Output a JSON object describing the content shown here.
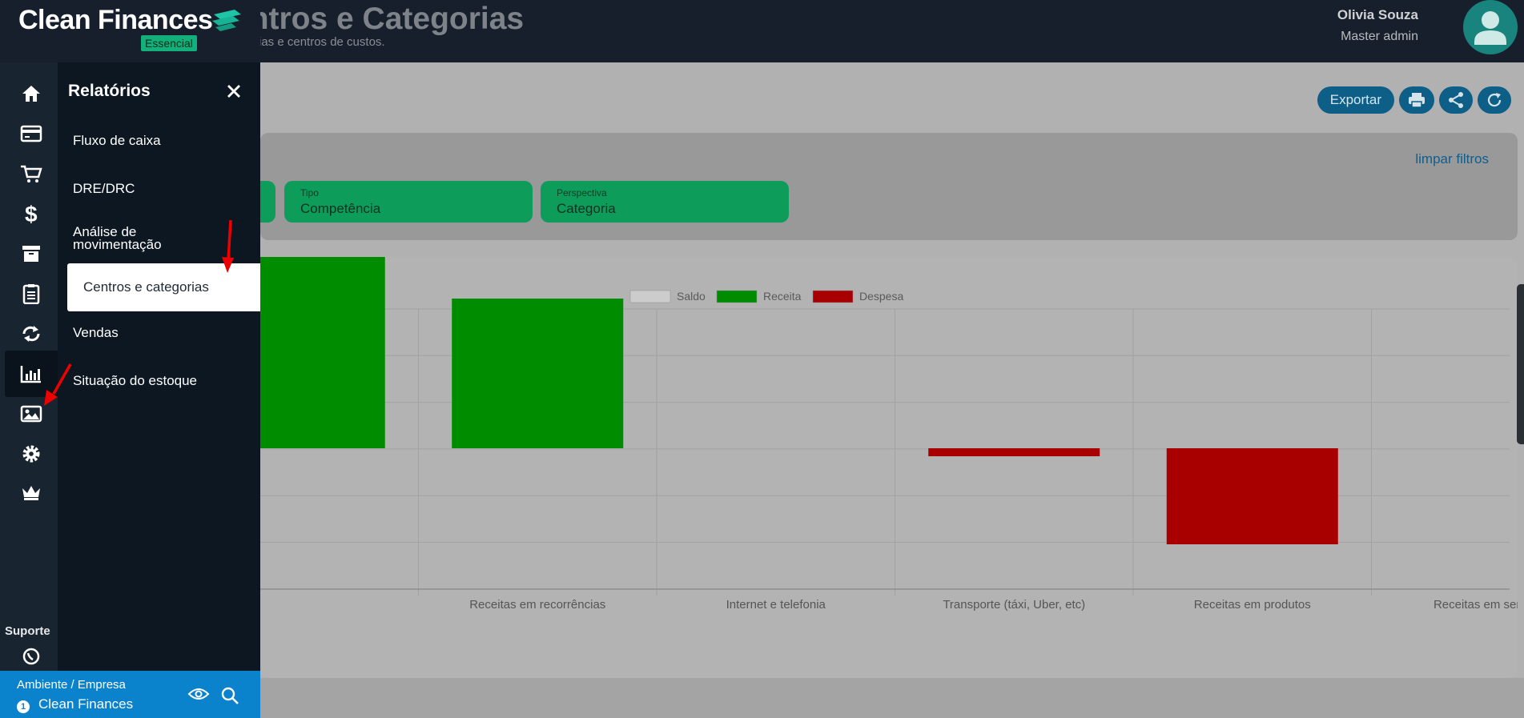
{
  "brand": {
    "name": "Clean Finances",
    "plan_badge": "Essencial"
  },
  "header": {
    "title": "entros e Categorias",
    "subtitle": "rias e centros de custos.",
    "user_name": "Olivia Souza",
    "user_role": "Master admin"
  },
  "rail": {
    "icons": [
      "home-icon",
      "credit-card-icon",
      "cart-icon",
      "dollar-icon",
      "archive-icon",
      "clipboard-icon",
      "transfer-icon",
      "bar-chart-icon",
      "image-icon",
      "gear-icon",
      "crown-icon",
      "whatsapp-icon"
    ],
    "active_icon": "bar-chart-icon",
    "support_label": "Suporte"
  },
  "submenu": {
    "title": "Relatórios",
    "items": [
      {
        "label": "Fluxo de caixa"
      },
      {
        "label": "DRE/DRC"
      },
      {
        "label": "Análise de movimentação"
      },
      {
        "label": "Centros e categorias",
        "active": true
      },
      {
        "label": "Vendas"
      },
      {
        "label": "Situação do estoque"
      }
    ]
  },
  "footer": {
    "env_label": "Ambiente / Empresa",
    "env_number": "1",
    "env_name": "Clean Finances"
  },
  "toolbar": {
    "export_label": "Exportar",
    "icons": [
      "print-icon",
      "share-icon",
      "refresh-icon"
    ]
  },
  "filters": {
    "clear_label": "limpar filtros",
    "tipo": {
      "label": "Tipo",
      "value": "Competência"
    },
    "perspectiva": {
      "label": "Perspectiva",
      "value": "Categoria"
    }
  },
  "colors": {
    "saldo": "#cccccc",
    "receita": "#008c00",
    "despesa": "#a80000",
    "accent": "#0b82cc",
    "filter_green": "#0e9c5b"
  },
  "chart_data": {
    "type": "bar",
    "legend": [
      "Saldo",
      "Receita",
      "Despesa"
    ],
    "categories": [
      "",
      "Receitas em recorrências",
      "Internet e telefonia",
      "Transporte (táxi, Uber, etc)",
      "Receitas em produtos",
      "Receitas em serviços"
    ],
    "series": [
      {
        "name": "Receita",
        "values": [
          2.6,
          1.87,
          0,
          0,
          0,
          0
        ]
      },
      {
        "name": "Despesa",
        "values": [
          0,
          0,
          0,
          -0.1,
          -1.2,
          0
        ]
      }
    ]
  }
}
